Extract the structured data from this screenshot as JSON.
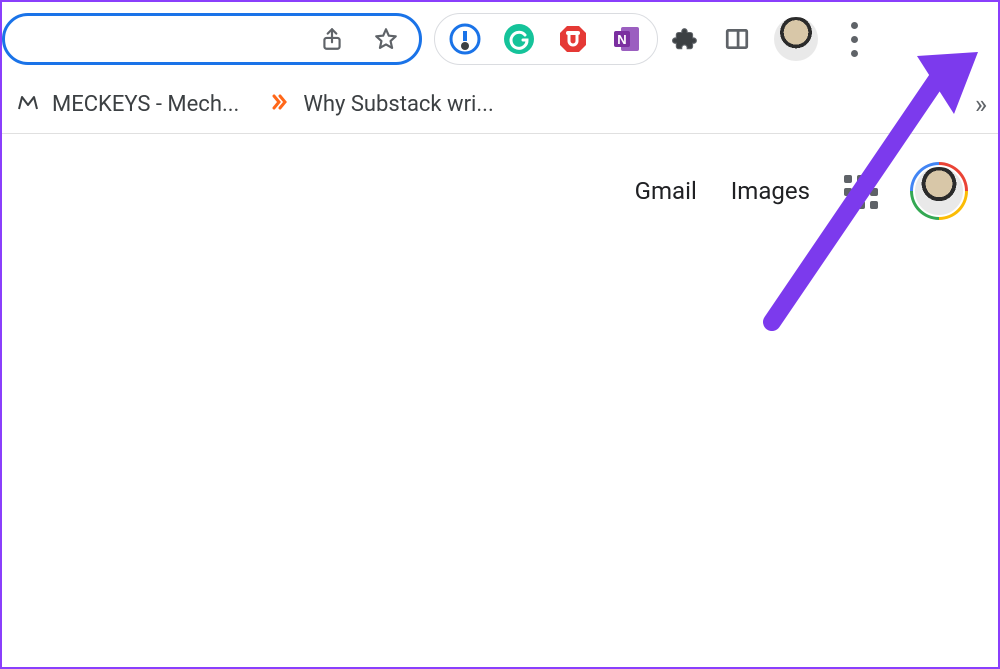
{
  "toolbar": {
    "omnibox_value": "",
    "share_icon": "share-icon",
    "star_icon": "star-icon",
    "extensions": [
      {
        "name": "onetab"
      },
      {
        "name": "grammarly"
      },
      {
        "name": "adblock"
      },
      {
        "name": "onenote"
      }
    ],
    "puzzle_icon": "extensions-icon",
    "panel_icon": "side-panel-icon",
    "menu_icon": "more-vertical-icon"
  },
  "bookmarks": [
    {
      "favicon": "meckeys",
      "label": "MECKEYS - Mech..."
    },
    {
      "favicon": "substack",
      "label": "Why Substack wri..."
    }
  ],
  "bookmarks_overflow": "»",
  "google_header": {
    "gmail": "Gmail",
    "images": "Images"
  },
  "annotation": {
    "arrow_color": "#7c3aed"
  }
}
